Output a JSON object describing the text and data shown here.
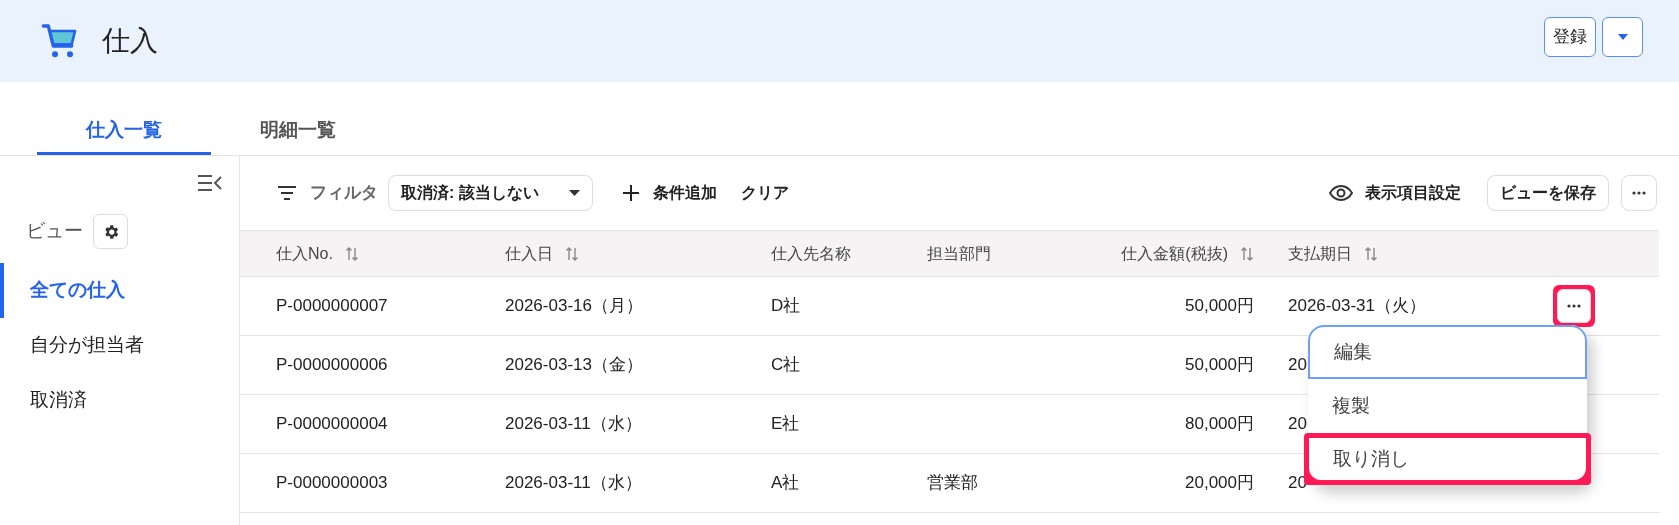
{
  "header": {
    "title": "仕入",
    "buttons": [
      {
        "kind": "text",
        "label": "登録"
      },
      {
        "kind": "caret"
      }
    ]
  },
  "tabs": [
    {
      "label": "仕入一覧",
      "selected": true
    },
    {
      "label": "明細一覧",
      "selected": false
    }
  ],
  "sidebar": {
    "heading": "ビュー",
    "items": [
      {
        "label": "全ての仕入",
        "selected": true
      },
      {
        "label": "自分が担当者",
        "selected": false
      },
      {
        "label": "取消済",
        "selected": false
      }
    ]
  },
  "toolbar": {
    "filter_label": "フィルタ",
    "filter_chip": "取消済: 該当しない",
    "add_condition": "条件追加",
    "clear": "クリア",
    "columns_setting": "表示項目設定",
    "save_view": "ビューを保存"
  },
  "table": {
    "columns": [
      {
        "label": "仕入No.",
        "sortable": true
      },
      {
        "label": "仕入日",
        "sortable": true
      },
      {
        "label": "仕入先名称",
        "sortable": false
      },
      {
        "label": "担当部門",
        "sortable": false
      },
      {
        "label": "仕入金額(税抜)",
        "sortable": true
      },
      {
        "label": "支払期日",
        "sortable": true
      }
    ],
    "rows": [
      {
        "cells": [
          "P-0000000007",
          "2026-03-16（月）",
          "D社",
          "",
          "50,000円",
          "2026-03-31（火）"
        ],
        "action_button": true,
        "highlighted": true
      },
      {
        "cells": [
          "P-0000000006",
          "2026-03-13（金）",
          "C社",
          "",
          "50,000円",
          "20"
        ],
        "action_button": false,
        "highlighted": false
      },
      {
        "cells": [
          "P-0000000004",
          "2026-03-11（水）",
          "E社",
          "",
          "80,000円",
          "20"
        ],
        "action_button": false,
        "highlighted": false
      },
      {
        "cells": [
          "P-0000000003",
          "2026-03-11（水）",
          "A社",
          "営業部",
          "20,000円",
          "20"
        ],
        "action_button": false,
        "highlighted": false
      }
    ]
  },
  "row_menu": {
    "items": [
      {
        "label": "編集",
        "focused": true,
        "highlighted": false
      },
      {
        "label": "複製",
        "focused": false,
        "highlighted": false
      },
      {
        "label": "取り消し",
        "focused": false,
        "highlighted": true
      }
    ]
  }
}
